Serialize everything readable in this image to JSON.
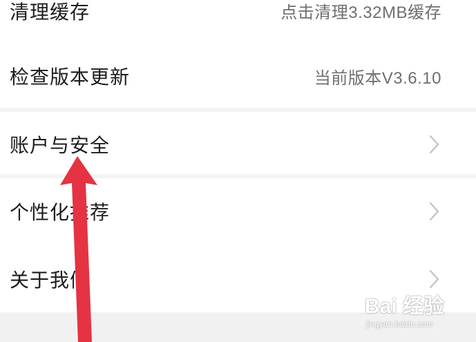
{
  "settings": {
    "items": [
      {
        "label": "清理缓存",
        "value": "点击清理3.32MB缓存"
      },
      {
        "label": "检查版本更新",
        "value": "当前版本V3.6.10"
      },
      {
        "label": "账户与安全",
        "value": ""
      },
      {
        "label": "个性化推荐",
        "value": ""
      },
      {
        "label": "关于我们",
        "value": ""
      }
    ]
  },
  "annotation": {
    "arrow_color": "#e53343"
  },
  "watermark": {
    "logo": "Bai 经验",
    "url": "jingyan.baidu.com"
  },
  "icons": {
    "row_arrow": "chevron-right-icon"
  }
}
